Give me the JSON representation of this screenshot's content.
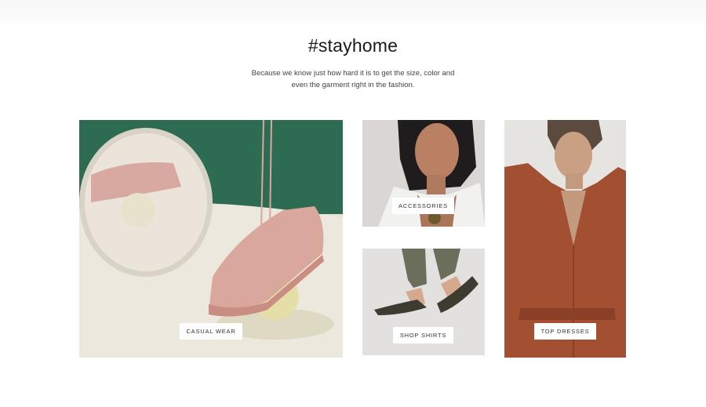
{
  "section": {
    "title": "#stayhome",
    "subtitle_line1": "Because we know just how hard it is to get the size, color and",
    "subtitle_line2": "even the garment right in the fashion."
  },
  "tiles": {
    "casual": {
      "label": "CASUAL WEAR",
      "image": "pink-sneaker-photo"
    },
    "accessories": {
      "label": "ACCESSORIES",
      "image": "woman-necklace-photo"
    },
    "shirts": {
      "label": "SHOP SHIRTS",
      "image": "sandals-photo"
    },
    "dresses": {
      "label": "TOP DRESSES",
      "image": "rust-dress-photo"
    }
  }
}
